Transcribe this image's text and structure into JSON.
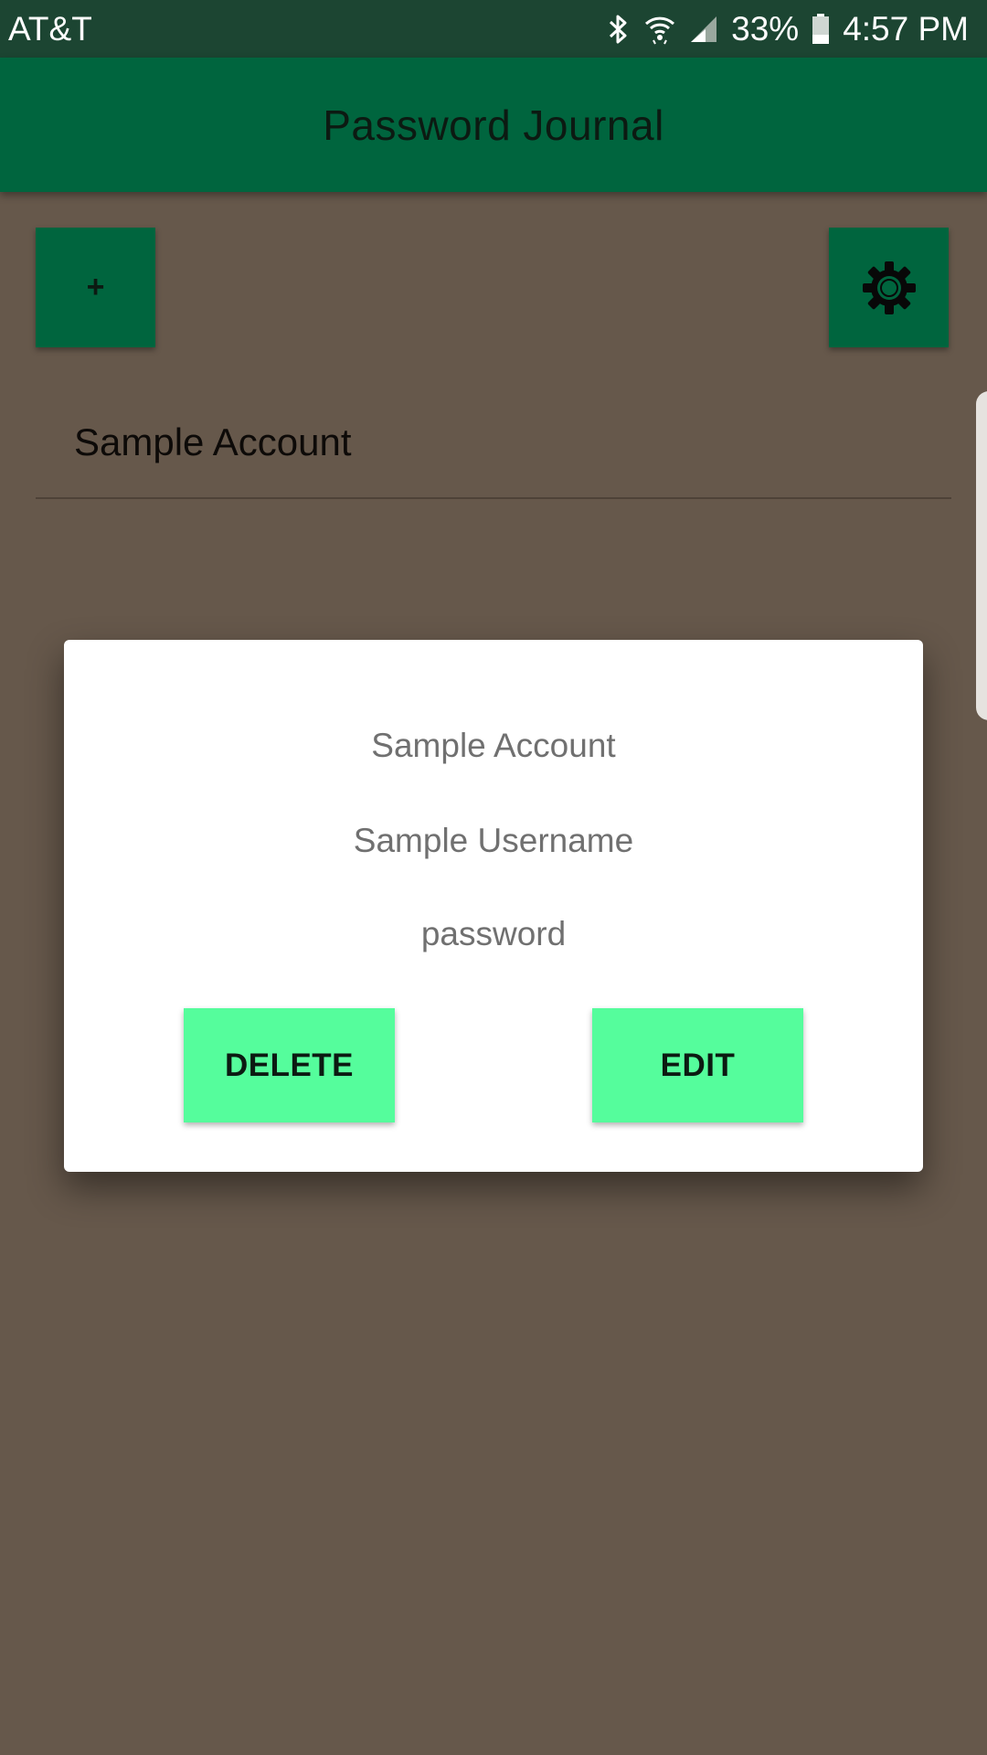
{
  "status_bar": {
    "carrier": "AT&T",
    "battery": "33%",
    "time": "4:57 PM",
    "icons": [
      "bluetooth-icon",
      "wifi-icon",
      "signal-icon",
      "battery-icon"
    ]
  },
  "app_bar": {
    "title": "Password Journal"
  },
  "toolbar": {
    "add_label": "+",
    "settings_icon": "gear-icon"
  },
  "accounts": [
    {
      "label": "Sample Account"
    }
  ],
  "dialog": {
    "account": "Sample Account",
    "username": "Sample Username",
    "password": "password",
    "delete_label": "DELETE",
    "edit_label": "EDIT"
  },
  "colors": {
    "status_bar": "#1c4532",
    "primary": "#00653e",
    "background": "#66584b",
    "accent": "#55fd9c",
    "dialog_text": "#707070"
  }
}
